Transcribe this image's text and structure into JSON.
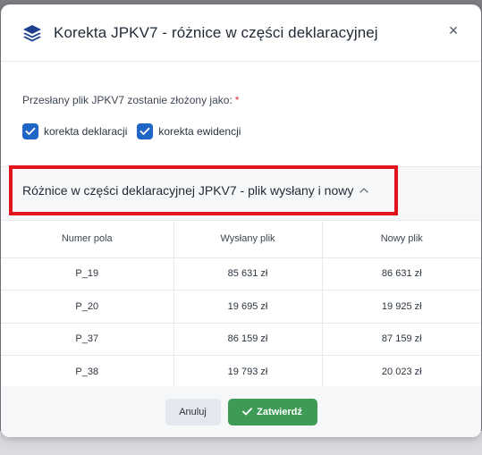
{
  "modal": {
    "title": "Korekta JPKV7 - różnice w części deklaracyjnej",
    "title_icon": "layers-icon",
    "close_icon": "close-icon",
    "close_label": "×"
  },
  "form": {
    "intro": "Przesłany plik JPKV7 zostanie złożony jako:",
    "required_mark": "*",
    "options": [
      {
        "label": "korekta deklaracji",
        "checked": true
      },
      {
        "label": "korekta ewidencji",
        "checked": true
      }
    ]
  },
  "section": {
    "title": "Różnice w części deklaracyjnej JPKV7 - plik wysłany i nowy",
    "expanded": true,
    "highlight_color": "#e2141b"
  },
  "table": {
    "headers": [
      "Numer pola",
      "Wysłany plik",
      "Nowy plik"
    ],
    "rows": [
      [
        "P_19",
        "85 631 zł",
        "86 631 zł"
      ],
      [
        "P_20",
        "19 695 zł",
        "19 925 zł"
      ],
      [
        "P_37",
        "86 159 zł",
        "87 159 zł"
      ],
      [
        "P_38",
        "19 793 zł",
        "20 023 zł"
      ]
    ]
  },
  "footer": {
    "cancel_label": "Anuluj",
    "confirm_label": "Zatwierdź",
    "confirm_color": "#3d9b55"
  }
}
